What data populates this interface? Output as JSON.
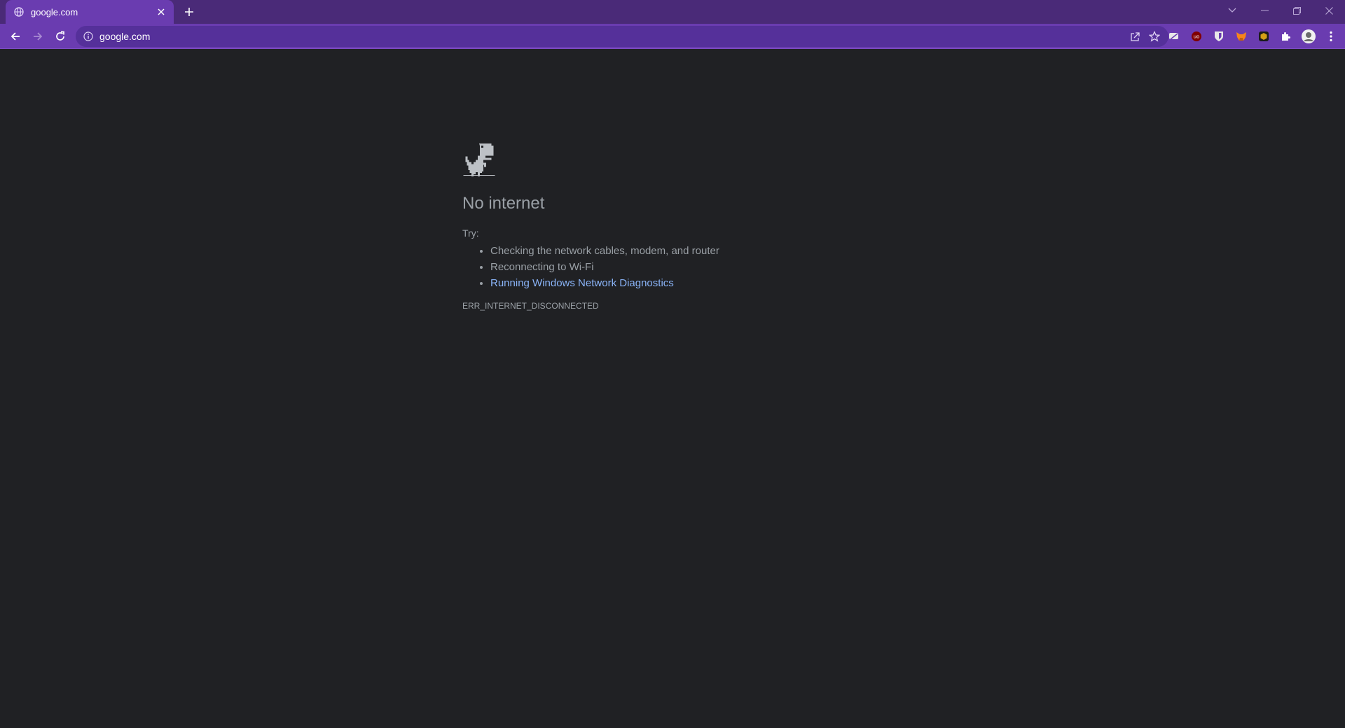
{
  "browser": {
    "tab": {
      "title": "google.com",
      "favicon": "globe-icon",
      "close": "close-icon"
    },
    "new_tab": "plus-icon",
    "window_controls": [
      "chevron-down-icon",
      "minimize-icon",
      "restore-icon",
      "close-icon"
    ],
    "toolbar": {
      "back": "back-arrow-icon",
      "forward": "forward-arrow-icon",
      "reload": "reload-icon",
      "address": "google.com",
      "site_info": "info-icon",
      "share": "share-icon",
      "bookmark": "star-icon",
      "extensions": [
        "stack-extension-icon",
        "ublock-icon",
        "bitwarden-icon",
        "metamask-icon",
        "package-extension-icon",
        "puzzle-icon"
      ],
      "profile": "avatar",
      "menu": "kebab-menu-icon"
    },
    "colors": {
      "frame": "#4a2a78",
      "toolbar": "#6a3cb0",
      "page_bg": "#202124",
      "link": "#8ab4f8",
      "text": "#9aa0a6"
    }
  },
  "error_page": {
    "icon": "dino-icon",
    "headline": "No internet",
    "try_label": "Try:",
    "suggestions": [
      "Checking the network cables, modem, and router",
      "Reconnecting to Wi-Fi"
    ],
    "diagnostics_link": "Running Windows Network Diagnostics",
    "error_code": "ERR_INTERNET_DISCONNECTED"
  }
}
